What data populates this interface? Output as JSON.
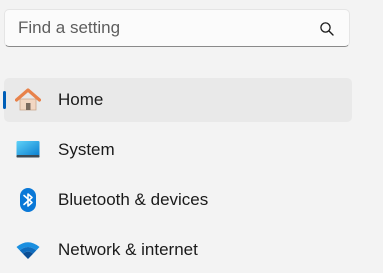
{
  "search": {
    "placeholder": "Find a setting",
    "icon": "search-icon"
  },
  "nav": {
    "items": [
      {
        "label": "Home",
        "icon": "home-icon",
        "selected": true
      },
      {
        "label": "System",
        "icon": "system-monitor-icon",
        "selected": false
      },
      {
        "label": "Bluetooth & devices",
        "icon": "bluetooth-icon",
        "selected": false
      },
      {
        "label": "Network & internet",
        "icon": "wifi-icon",
        "selected": false
      }
    ]
  },
  "colors": {
    "accent": "#005fb8",
    "selected_background": "#e9e9e9",
    "window_background": "#f3f3f3",
    "home_icon_orange": "#e8824a",
    "system_icon_blue": "#1aa0e8",
    "bluetooth_blue": "#0a78d7",
    "wifi_blue": "#0f6cbd"
  }
}
